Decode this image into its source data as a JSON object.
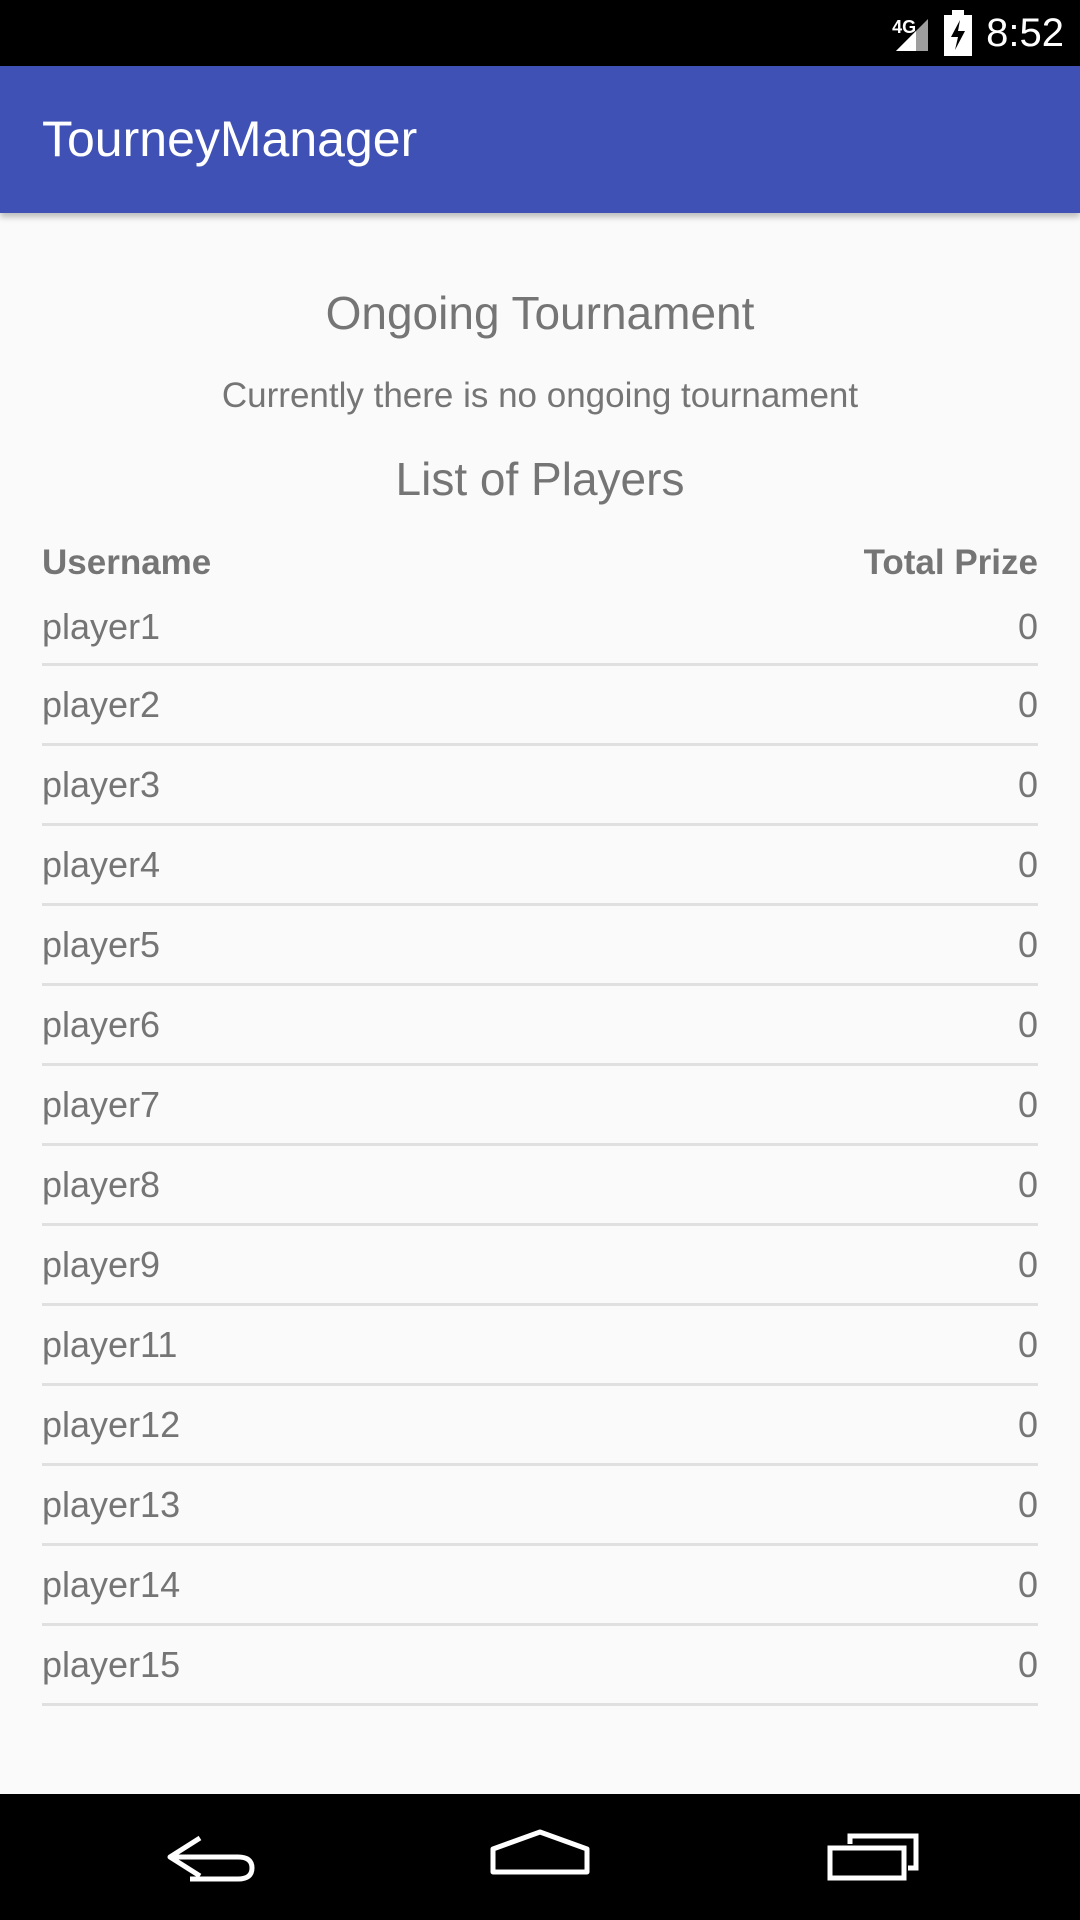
{
  "status_bar": {
    "network": "4G",
    "time": "8:52"
  },
  "app_bar": {
    "title": "TourneyManager"
  },
  "ongoing": {
    "title": "Ongoing Tournament",
    "message": "Currently there is no ongoing tournament"
  },
  "players": {
    "title": "List of Players",
    "header_username": "Username",
    "header_prize": "Total Prize",
    "rows": [
      {
        "username": "player1",
        "prize": "0"
      },
      {
        "username": "player2",
        "prize": "0"
      },
      {
        "username": "player3",
        "prize": "0"
      },
      {
        "username": "player4",
        "prize": "0"
      },
      {
        "username": "player5",
        "prize": "0"
      },
      {
        "username": "player6",
        "prize": "0"
      },
      {
        "username": "player7",
        "prize": "0"
      },
      {
        "username": "player8",
        "prize": "0"
      },
      {
        "username": "player9",
        "prize": "0"
      },
      {
        "username": "player11",
        "prize": "0"
      },
      {
        "username": "player12",
        "prize": "0"
      },
      {
        "username": "player13",
        "prize": "0"
      },
      {
        "username": "player14",
        "prize": "0"
      },
      {
        "username": "player15",
        "prize": "0"
      }
    ]
  },
  "nav_bar": {
    "icons": [
      "back-icon",
      "home-icon",
      "recent-apps-icon"
    ]
  },
  "colors": {
    "primary": "#3f51b5",
    "text_secondary": "#757575",
    "divider": "#e0e0e0",
    "background": "#fafafa"
  }
}
